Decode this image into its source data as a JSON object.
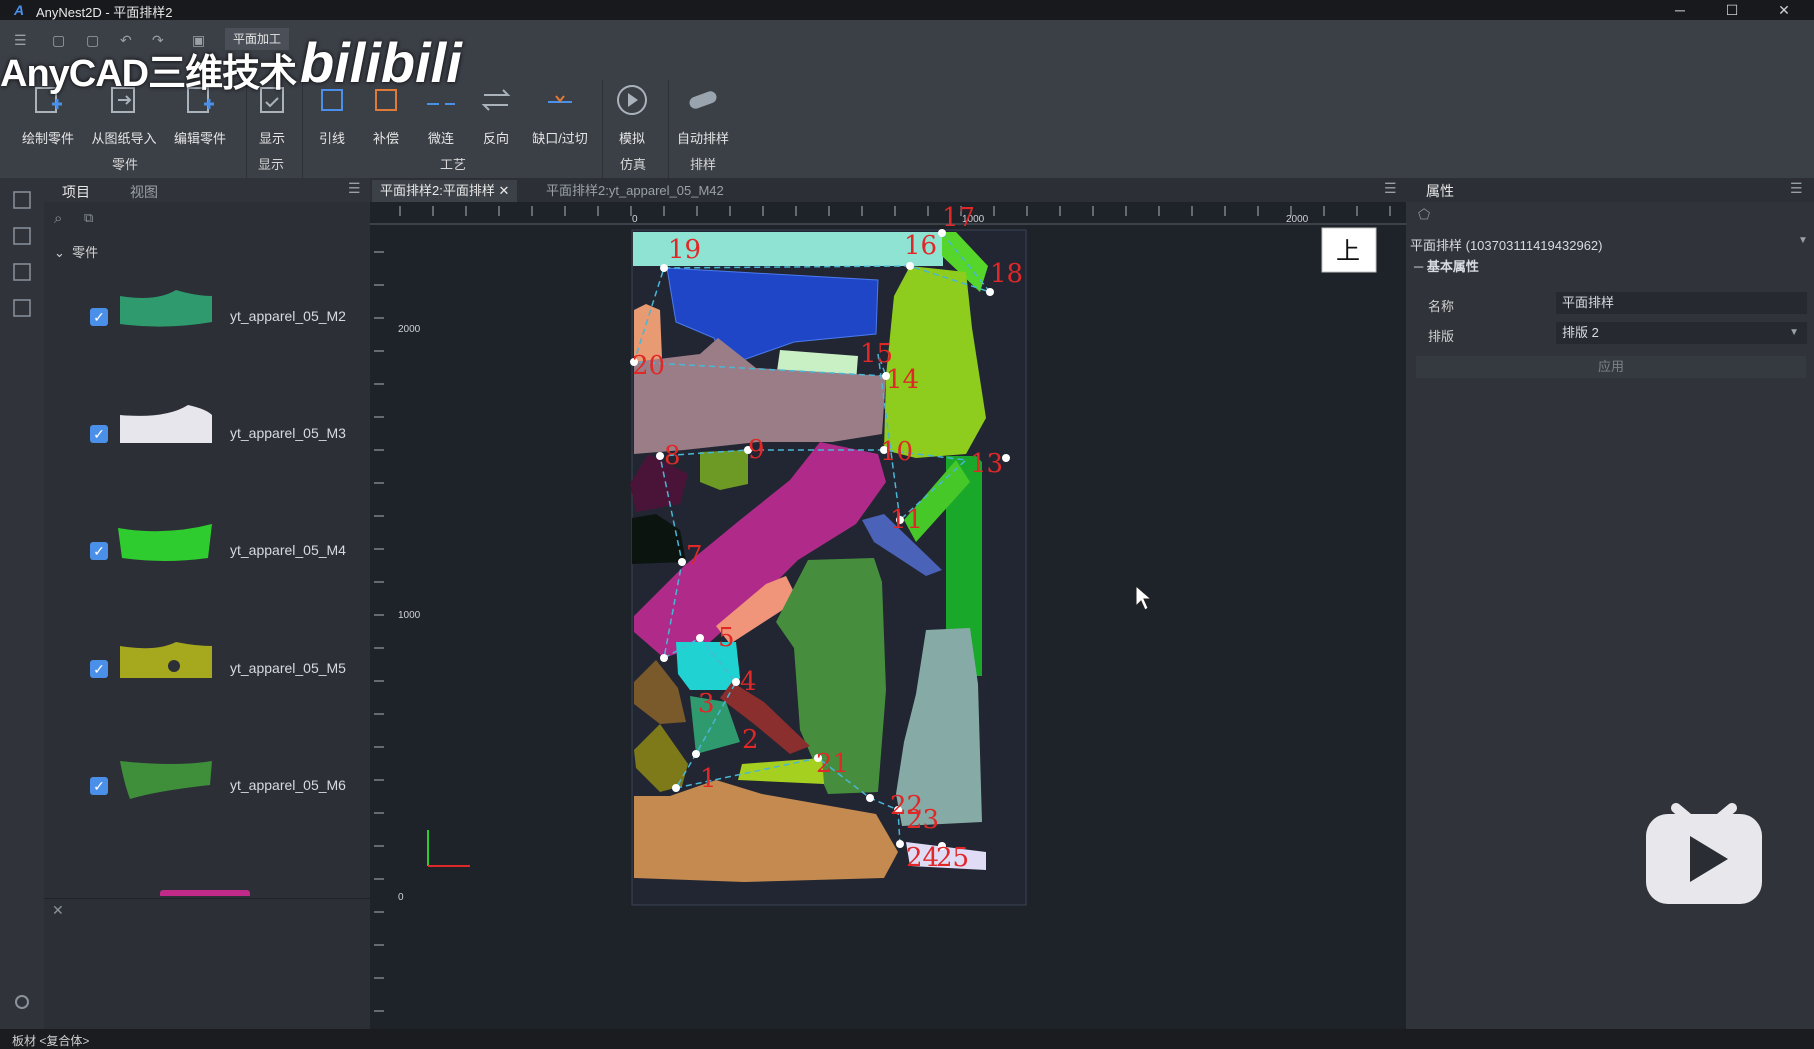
{
  "window": {
    "title": "AnyNest2D - 平面排样2",
    "minimize": "─",
    "maximize": "☐",
    "close": "✕"
  },
  "watermark": {
    "left": "AnyCAD三维技术",
    "right": "bilibili"
  },
  "ribbon": {
    "active_tab": "平面加工",
    "buttons": {
      "draw_part": "绘制零件",
      "import_drawing": "从图纸导入",
      "edit_part": "编辑零件",
      "display": "显示",
      "lead": "引线",
      "compensate": "补偿",
      "micro_joint": "微连",
      "reverse": "反向",
      "notch": "缺口/过切",
      "simulate": "模拟",
      "auto_nest": "自动排样"
    },
    "groups": {
      "part": "零件",
      "display": "显示",
      "process": "工艺",
      "simulation": "仿真",
      "nesting": "排样"
    }
  },
  "left_panel": {
    "tabs": [
      "项目",
      "视图"
    ],
    "tree_root": "零件",
    "items": [
      {
        "label": "yt_apparel_05_M2",
        "color": "#2e9a6e"
      },
      {
        "label": "yt_apparel_05_M3",
        "color": "#e6e6ec"
      },
      {
        "label": "yt_apparel_05_M4",
        "color": "#2ecc2e"
      },
      {
        "label": "yt_apparel_05_M5",
        "color": "#a6a81e"
      },
      {
        "label": "yt_apparel_05_M6",
        "color": "#3e8e3a"
      }
    ]
  },
  "canvas": {
    "tabs": [
      "平面排样2:平面排样",
      "平面排样2:yt_apparel_05_M42"
    ],
    "view_label": "上",
    "ruler_top": [
      "0",
      "1000",
      "2000"
    ],
    "ruler_left": [
      "2000",
      "1000",
      "0"
    ],
    "path_labels": [
      "1",
      "2",
      "3",
      "4",
      "5",
      "7",
      "8",
      "9",
      "10",
      "11",
      "13",
      "14",
      "15",
      "16",
      "17",
      "18",
      "19",
      "20",
      "21",
      "22",
      "23",
      "24",
      "25"
    ]
  },
  "right_panel": {
    "tab": "属性",
    "selector": "平面排样 (103703111419432962)",
    "section": "基本属性",
    "name_label": "名称",
    "name_value": "平面排样",
    "layout_label": "排版",
    "layout_value": "排版 2",
    "apply": "应用"
  },
  "status": "板材 <复合体>"
}
